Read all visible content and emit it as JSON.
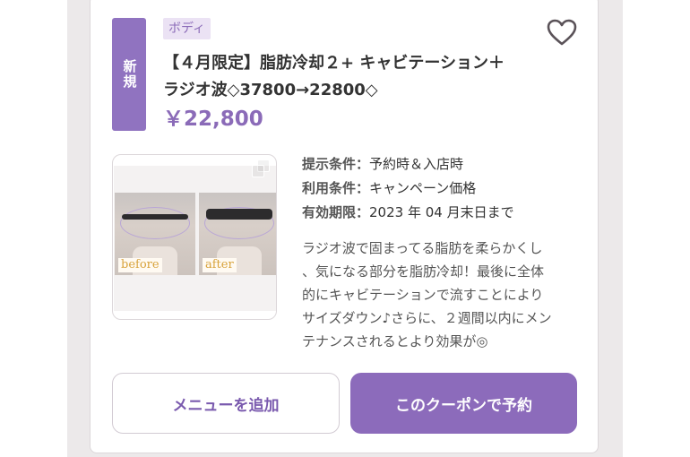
{
  "coupon": {
    "new_badge": "新規",
    "category": "ボディ",
    "title_lines": [
      "【４月限定】脂肪冷却２+ キャビテーション＋",
      "ラジオ波◇37800→22800◇"
    ],
    "price": "￥22,800",
    "thumbnail": {
      "before_label": "before",
      "after_label": "after"
    },
    "conditions": [
      {
        "label": "提示条件：",
        "value": "予約時＆入店時"
      },
      {
        "label": "利用条件：",
        "value": "キャンペーン価格"
      },
      {
        "label": "有効期限：",
        "value": "2023 年 04 月末日まで"
      }
    ],
    "description_lines": [
      "ラジオ波で固まってる脂肪を柔らかくし",
      "、気になる部分を脂肪冷却！最後に全体",
      "的にキャビテーションで流すことにより",
      "サイズダウン♪さらに、２週間以内にメン",
      "テナンスされるとより効果が◎"
    ],
    "buttons": {
      "add_menu": "メニューを追加",
      "reserve": "このクーポンで予約"
    }
  },
  "colors": {
    "accent": "#8c6bbb",
    "tag_bg": "#ebe2f4",
    "page_side": "#ece9ea"
  },
  "icons": {
    "favorite": "heart-icon",
    "gallery": "copy-icon"
  }
}
